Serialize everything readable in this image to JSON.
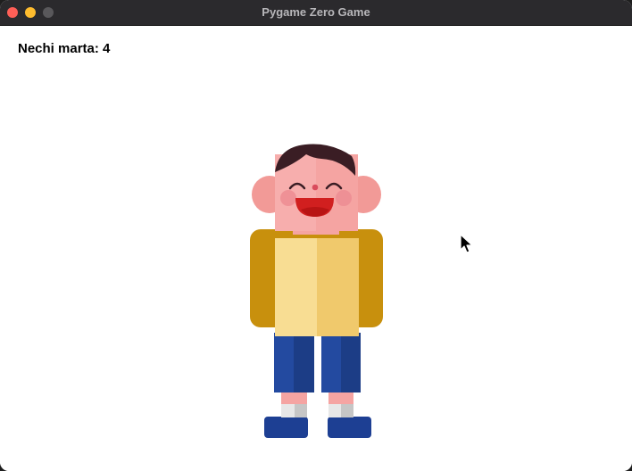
{
  "window": {
    "title": "Pygame Zero Game",
    "controls": [
      "close",
      "minimize",
      "zoom"
    ]
  },
  "game": {
    "score_text": "Nechi marta: 4",
    "actor": "boy-character",
    "cursor": "arrow-cursor"
  },
  "colors": {
    "shirt_outer": "#c8900d",
    "shirt_inner": "#f8dd93",
    "pants": "#234aa0",
    "skin": "#f5a4a2",
    "hair": "#3a1d24",
    "mouth": "#d11f1f"
  }
}
